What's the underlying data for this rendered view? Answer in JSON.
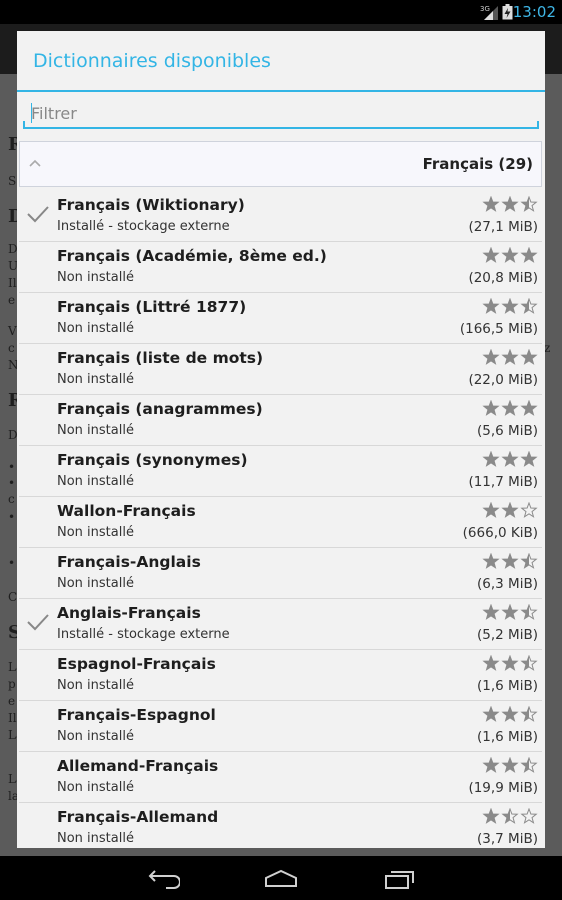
{
  "status_bar": {
    "time": "13:02",
    "network": "3G"
  },
  "dialog": {
    "title": "Dictionnaires disponibles",
    "filter_placeholder": "Filtrer",
    "group": {
      "label": "Français (29)"
    }
  },
  "dictionaries": [
    {
      "name": "Français (Wiktionary)",
      "status": "Installé - stockage externe",
      "size": "(27,1 MiB)",
      "rating": 2.5,
      "installed": true
    },
    {
      "name": "Français (Académie, 8ème ed.)",
      "status": "Non installé",
      "size": "(20,8 MiB)",
      "rating": 3,
      "installed": false
    },
    {
      "name": "Français (Littré 1877)",
      "status": "Non installé",
      "size": "(166,5 MiB)",
      "rating": 2.5,
      "installed": false
    },
    {
      "name": "Français (liste de mots)",
      "status": "Non installé",
      "size": "(22,0 MiB)",
      "rating": 3,
      "installed": false
    },
    {
      "name": "Français (anagrammes)",
      "status": "Non installé",
      "size": "(5,6 MiB)",
      "rating": 3,
      "installed": false
    },
    {
      "name": "Français (synonymes)",
      "status": "Non installé",
      "size": "(11,7 MiB)",
      "rating": 3,
      "installed": false
    },
    {
      "name": "Wallon-Français",
      "status": "Non installé",
      "size": "(666,0 KiB)",
      "rating": 2,
      "installed": false
    },
    {
      "name": "Français-Anglais",
      "status": "Non installé",
      "size": "(6,3 MiB)",
      "rating": 2.5,
      "installed": false
    },
    {
      "name": "Anglais-Français",
      "status": "Installé - stockage externe",
      "size": "(5,2 MiB)",
      "rating": 2.5,
      "installed": true
    },
    {
      "name": "Espagnol-Français",
      "status": "Non installé",
      "size": "(1,6 MiB)",
      "rating": 2.5,
      "installed": false
    },
    {
      "name": "Français-Espagnol",
      "status": "Non installé",
      "size": "(1,6 MiB)",
      "rating": 2.5,
      "installed": false
    },
    {
      "name": "Allemand-Français",
      "status": "Non installé",
      "size": "(19,9 MiB)",
      "rating": 2.5,
      "installed": false
    },
    {
      "name": "Français-Allemand",
      "status": "Non installé",
      "size": "(3,7 MiB)",
      "rating": 1.5,
      "installed": false
    }
  ],
  "colors": {
    "accent": "#33b5e5",
    "star": "#8a8a8a",
    "check": "#888888"
  }
}
